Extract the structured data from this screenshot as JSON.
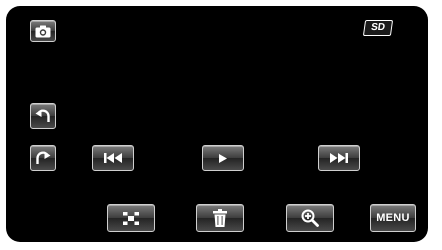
{
  "screen": {
    "mode_icon": "camera-icon",
    "media_badge": "SD",
    "colors": {
      "background": "#000000",
      "button_border": "#cfcfcf",
      "button_face_top": "#7b7b7b",
      "button_face_bottom": "#242424",
      "icon": "#ffffff"
    }
  },
  "controls": {
    "rotate_left_icon": "rotate-counterclockwise-icon",
    "rotate_right_icon": "rotate-clockwise-icon",
    "previous_icon": "skip-previous-icon",
    "play_icon": "play-icon",
    "next_icon": "skip-next-icon",
    "index_icon": "thumbnail-grid-icon",
    "delete_icon": "trash-icon",
    "zoom_icon": "zoom-in-icon",
    "menu_label": "MENU"
  }
}
